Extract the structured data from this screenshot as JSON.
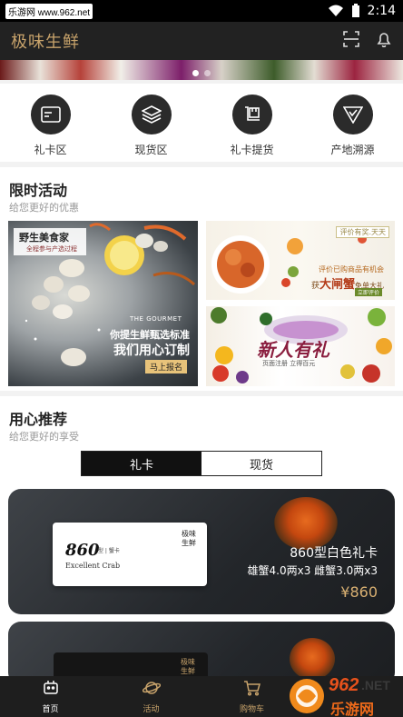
{
  "status_bar": {
    "watermark": "乐游网 www.962.net",
    "time": "2:14"
  },
  "header": {
    "title": "极味生鲜",
    "icons": [
      "scan-icon",
      "bell-icon"
    ]
  },
  "banner": {
    "dots": 2,
    "active_index": 0
  },
  "categories": [
    {
      "label": "礼卡区",
      "icon": "card-icon"
    },
    {
      "label": "现货区",
      "icon": "layers-icon"
    },
    {
      "label": "礼卡提货",
      "icon": "pickup-icon"
    },
    {
      "label": "产地溯源",
      "icon": "trace-icon"
    }
  ],
  "promo_section": {
    "title": "限时活动",
    "subtitle": "给您更好的优惠",
    "big_banner": {
      "corner_title": "野生美食家",
      "corner_sub": "全程参与产选过程",
      "brand": "THE GOURMET",
      "line1": "你提生鲜甄选标准",
      "line2": "我们用心订制",
      "cta": "马上报名"
    },
    "small_banner1": {
      "tag": "评价有奖.天天",
      "line1": "评价已购商品有机会",
      "line2_prefix": "获",
      "line2_highlight": "大闸蟹",
      "line2_suffix": "免单大礼",
      "button": "立即评价"
    },
    "small_banner2": {
      "title": "新人有礼",
      "sub": "页面注册 立得百元"
    }
  },
  "recommend_section": {
    "title": "用心推荐",
    "subtitle": "给您更好的享受",
    "tabs": [
      {
        "label": "礼卡",
        "active": true
      },
      {
        "label": "现货",
        "active": false
      }
    ]
  },
  "products": [
    {
      "name": "860型白色礼卡",
      "detail": "雄蟹4.0两x3 雌蟹3.0两x3",
      "price": "¥860",
      "card": {
        "number": "860",
        "sub": "型 | 蟹卡",
        "english": "Excellent Crab",
        "brand_line1": "极味",
        "brand_line2": "生鲜"
      }
    },
    {
      "card": {
        "brand_line1": "极味",
        "brand_line2": "生鲜"
      }
    }
  ],
  "bottom_nav": [
    {
      "label": "首页",
      "icon": "home-robot-icon",
      "active": true
    },
    {
      "label": "活动",
      "icon": "planet-icon",
      "active": false
    },
    {
      "label": "购物车",
      "icon": "cart-icon",
      "active": false
    }
  ],
  "overlay_logo": {
    "text_top": "962",
    "text_dot_net": ".NET",
    "text_bottom": "乐游网"
  },
  "colors": {
    "accent_gold": "#c8a36b",
    "header_bg": "#222222",
    "price_gold": "#d9b072"
  }
}
